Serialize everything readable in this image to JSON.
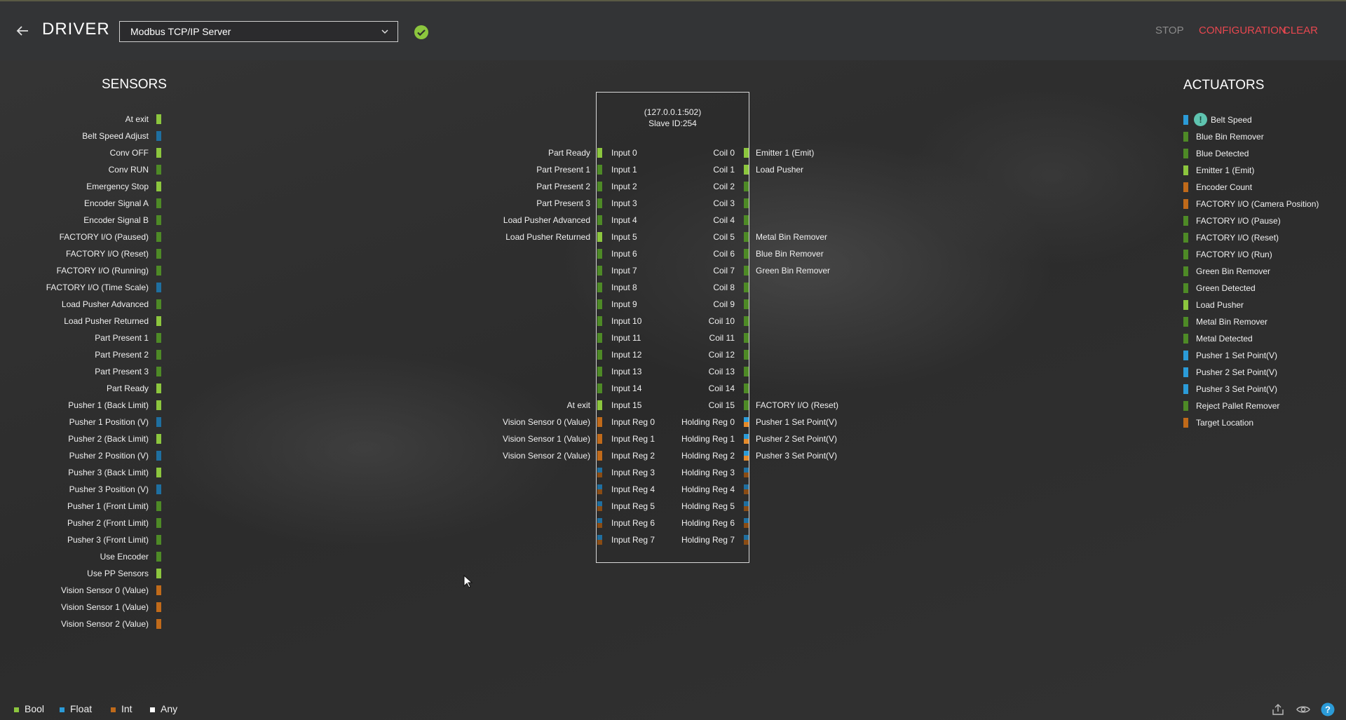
{
  "colors": {
    "bool_bright": "#8cc63e",
    "bool_dark": "#4e8a26",
    "float": "#2b9bd8",
    "float_dark": "#1f6fa0",
    "int": "#c06a1a",
    "any": "#ffffff",
    "accent": "#e8474f"
  },
  "header": {
    "title": "DRIVER",
    "driver": "Modbus TCP/IP Server",
    "stop": "STOP",
    "configuration": "CONFIGURATION",
    "clear": "CLEAR"
  },
  "sensors": {
    "title": "SENSORS",
    "items": [
      {
        "label": "At exit",
        "type": "bool_bright"
      },
      {
        "label": "Belt Speed Adjust",
        "type": "float_dark"
      },
      {
        "label": "Conv OFF",
        "type": "bool_bright"
      },
      {
        "label": "Conv RUN",
        "type": "bool_dark"
      },
      {
        "label": "Emergency Stop",
        "type": "bool_bright"
      },
      {
        "label": "Encoder Signal A",
        "type": "bool_dark"
      },
      {
        "label": "Encoder Signal B",
        "type": "bool_dark"
      },
      {
        "label": "FACTORY I/O (Paused)",
        "type": "bool_dark"
      },
      {
        "label": "FACTORY I/O (Reset)",
        "type": "bool_dark"
      },
      {
        "label": "FACTORY I/O (Running)",
        "type": "bool_dark"
      },
      {
        "label": "FACTORY I/O (Time Scale)",
        "type": "float_dark"
      },
      {
        "label": "Load Pusher Advanced",
        "type": "bool_dark"
      },
      {
        "label": "Load Pusher Returned",
        "type": "bool_bright"
      },
      {
        "label": "Part Present 1",
        "type": "bool_dark"
      },
      {
        "label": "Part Present 2",
        "type": "bool_dark"
      },
      {
        "label": "Part Present 3",
        "type": "bool_dark"
      },
      {
        "label": "Part Ready",
        "type": "bool_bright"
      },
      {
        "label": "Pusher 1 (Back Limit)",
        "type": "bool_bright"
      },
      {
        "label": "Pusher 1 Position (V)",
        "type": "float_dark"
      },
      {
        "label": "Pusher 2 (Back Limit)",
        "type": "bool_bright"
      },
      {
        "label": "Pusher 2 Position (V)",
        "type": "float_dark"
      },
      {
        "label": "Pusher 3 (Back Limit)",
        "type": "bool_bright"
      },
      {
        "label": "Pusher 3 Position (V)",
        "type": "float_dark"
      },
      {
        "label": "Pusher 1 (Front Limit)",
        "type": "bool_dark"
      },
      {
        "label": "Pusher 2 (Front Limit)",
        "type": "bool_dark"
      },
      {
        "label": "Pusher 3 (Front Limit)",
        "type": "bool_dark"
      },
      {
        "label": "Use Encoder",
        "type": "bool_dark"
      },
      {
        "label": "Use PP Sensors",
        "type": "bool_bright"
      },
      {
        "label": "Vision Sensor 0 (Value)",
        "type": "int"
      },
      {
        "label": "Vision Sensor 1 (Value)",
        "type": "int"
      },
      {
        "label": "Vision Sensor 2 (Value)",
        "type": "int"
      }
    ]
  },
  "actuators": {
    "title": "ACTUATORS",
    "items": [
      {
        "label": "Belt Speed",
        "type": "float",
        "warn": true
      },
      {
        "label": "Blue Bin Remover",
        "type": "bool_dark"
      },
      {
        "label": "Blue Detected",
        "type": "bool_dark"
      },
      {
        "label": "Emitter 1 (Emit)",
        "type": "bool_bright"
      },
      {
        "label": "Encoder Count",
        "type": "int"
      },
      {
        "label": "FACTORY I/O (Camera Position)",
        "type": "int"
      },
      {
        "label": "FACTORY I/O (Pause)",
        "type": "bool_dark"
      },
      {
        "label": "FACTORY I/O (Reset)",
        "type": "bool_dark"
      },
      {
        "label": "FACTORY I/O (Run)",
        "type": "bool_dark"
      },
      {
        "label": "Green Bin Remover",
        "type": "bool_dark"
      },
      {
        "label": "Green Detected",
        "type": "bool_dark"
      },
      {
        "label": "Load Pusher",
        "type": "bool_bright"
      },
      {
        "label": "Metal Bin Remover",
        "type": "bool_dark"
      },
      {
        "label": "Metal Detected",
        "type": "bool_dark"
      },
      {
        "label": "Pusher 1 Set Point(V)",
        "type": "float"
      },
      {
        "label": "Pusher 2 Set Point(V)",
        "type": "float"
      },
      {
        "label": "Pusher 3 Set Point(V)",
        "type": "float"
      },
      {
        "label": "Reject Pallet Remover",
        "type": "bool_dark"
      },
      {
        "label": "Target Location",
        "type": "int"
      }
    ]
  },
  "modbus": {
    "address": "(127.0.0.1:502)",
    "slave": "Slave ID:254",
    "rows": [
      {
        "inLabel": "Part Ready",
        "in": "Input 0",
        "out": "Coil 0",
        "outLabel": "Emitter 1 (Emit)",
        "inType": "bool_bright",
        "outType": "bool_bright"
      },
      {
        "inLabel": "Part Present 1",
        "in": "Input 1",
        "out": "Coil 1",
        "outLabel": "Load Pusher",
        "inType": "bool_dark",
        "outType": "bool_bright"
      },
      {
        "inLabel": "Part Present 2",
        "in": "Input 2",
        "out": "Coil 2",
        "outLabel": "",
        "inType": "bool_dark",
        "outType": "bool_dark"
      },
      {
        "inLabel": "Part Present 3",
        "in": "Input 3",
        "out": "Coil 3",
        "outLabel": "",
        "inType": "bool_dark",
        "outType": "bool_dark"
      },
      {
        "inLabel": "Load Pusher Advanced",
        "in": "Input 4",
        "out": "Coil 4",
        "outLabel": "",
        "inType": "bool_dark",
        "outType": "bool_dark"
      },
      {
        "inLabel": "Load Pusher Returned",
        "in": "Input 5",
        "out": "Coil 5",
        "outLabel": "Metal Bin Remover",
        "inType": "bool_bright",
        "outType": "bool_dark"
      },
      {
        "inLabel": "",
        "in": "Input 6",
        "out": "Coil 6",
        "outLabel": "Blue Bin Remover",
        "inType": "bool_dark",
        "outType": "bool_dark"
      },
      {
        "inLabel": "",
        "in": "Input 7",
        "out": "Coil 7",
        "outLabel": "Green Bin Remover",
        "inType": "bool_dark",
        "outType": "bool_dark"
      },
      {
        "inLabel": "",
        "in": "Input 8",
        "out": "Coil 8",
        "outLabel": "",
        "inType": "bool_dark",
        "outType": "bool_dark"
      },
      {
        "inLabel": "",
        "in": "Input 9",
        "out": "Coil 9",
        "outLabel": "",
        "inType": "bool_dark",
        "outType": "bool_dark"
      },
      {
        "inLabel": "",
        "in": "Input 10",
        "out": "Coil 10",
        "outLabel": "",
        "inType": "bool_dark",
        "outType": "bool_dark"
      },
      {
        "inLabel": "",
        "in": "Input 11",
        "out": "Coil 11",
        "outLabel": "",
        "inType": "bool_dark",
        "outType": "bool_dark"
      },
      {
        "inLabel": "",
        "in": "Input 12",
        "out": "Coil 12",
        "outLabel": "",
        "inType": "bool_dark",
        "outType": "bool_dark"
      },
      {
        "inLabel": "",
        "in": "Input 13",
        "out": "Coil 13",
        "outLabel": "",
        "inType": "bool_dark",
        "outType": "bool_dark"
      },
      {
        "inLabel": "",
        "in": "Input 14",
        "out": "Coil 14",
        "outLabel": "",
        "inType": "bool_dark",
        "outType": "bool_dark"
      },
      {
        "inLabel": "At exit",
        "in": "Input 15",
        "out": "Coil 15",
        "outLabel": "FACTORY I/O (Reset)",
        "inType": "bool_bright",
        "outType": "bool_dark"
      },
      {
        "inLabel": "Vision Sensor 0 (Value)",
        "in": "Input Reg 0",
        "out": "Holding Reg 0",
        "outLabel": "Pusher 1 Set Point(V)",
        "inType": "int",
        "outType": "float_int"
      },
      {
        "inLabel": "Vision Sensor 1 (Value)",
        "in": "Input Reg 1",
        "out": "Holding Reg 1",
        "outLabel": "Pusher 2 Set Point(V)",
        "inType": "int",
        "outType": "float_int"
      },
      {
        "inLabel": "Vision Sensor 2 (Value)",
        "in": "Input Reg 2",
        "out": "Holding Reg 2",
        "outLabel": "Pusher 3 Set Point(V)",
        "inType": "int",
        "outType": "float_int"
      },
      {
        "inLabel": "",
        "in": "Input Reg 3",
        "out": "Holding Reg 3",
        "outLabel": "",
        "inType": "reg_dark",
        "outType": "reg_dark"
      },
      {
        "inLabel": "",
        "in": "Input Reg 4",
        "out": "Holding Reg 4",
        "outLabel": "",
        "inType": "reg_dark",
        "outType": "reg_dark"
      },
      {
        "inLabel": "",
        "in": "Input Reg 5",
        "out": "Holding Reg 5",
        "outLabel": "",
        "inType": "reg_dark",
        "outType": "reg_dark"
      },
      {
        "inLabel": "",
        "in": "Input Reg 6",
        "out": "Holding Reg 6",
        "outLabel": "",
        "inType": "reg_dark",
        "outType": "reg_dark"
      },
      {
        "inLabel": "",
        "in": "Input Reg 7",
        "out": "Holding Reg 7",
        "outLabel": "",
        "inType": "reg_dark",
        "outType": "reg_dark"
      }
    ]
  },
  "legend": [
    {
      "label": "Bool",
      "type": "bool_bright"
    },
    {
      "label": "Float",
      "type": "float"
    },
    {
      "label": "Int",
      "type": "int"
    },
    {
      "label": "Any",
      "type": "any"
    }
  ],
  "icons": {
    "back": "arrow-left-icon",
    "ok": "check-circle-icon",
    "chevron": "chevron-down-icon",
    "export": "export-icon",
    "eye": "eye-icon",
    "help": "help-icon",
    "warn": "warning-icon"
  }
}
